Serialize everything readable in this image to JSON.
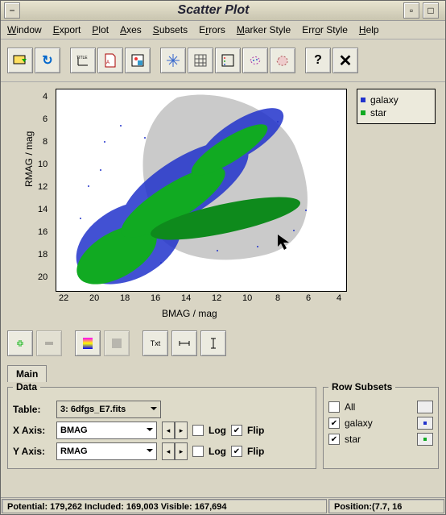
{
  "window": {
    "title": "Scatter Plot"
  },
  "menu": {
    "window": "Window",
    "export": "Export",
    "plot": "Plot",
    "axes": "Axes",
    "subsets": "Subsets",
    "errors": "Errors",
    "marker": "Marker Style",
    "errstyle": "Error Style",
    "help": "Help"
  },
  "chart_data": {
    "type": "scatter",
    "xlabel": "BMAG / mag",
    "ylabel": "RMAG / mag",
    "xlim": [
      23,
      3
    ],
    "ylim": [
      21,
      3
    ],
    "x_ticks": [
      22,
      20,
      18,
      16,
      14,
      12,
      10,
      8,
      6,
      4
    ],
    "y_ticks": [
      4,
      6,
      8,
      10,
      12,
      14,
      16,
      18,
      20
    ],
    "series": [
      {
        "name": "galaxy",
        "color": "#2233cc",
        "n_approx": 90000
      },
      {
        "name": "star",
        "color": "#11aa22",
        "n_approx": 79000
      }
    ],
    "annotations": [
      {
        "type": "freehand-selection",
        "description": "grey blob region roughly (BMAG 6–17, RMAG 3–18)"
      }
    ]
  },
  "legend": {
    "items": [
      {
        "label": "galaxy",
        "color": "#2233cc"
      },
      {
        "label": "star",
        "color": "#11aa22"
      }
    ]
  },
  "tabs": {
    "main": "Main"
  },
  "data_panel": {
    "legend": "Data",
    "table_label": "Table:",
    "table_value": "3: 6dfgs_E7.fits",
    "xaxis_label": "X Axis:",
    "xaxis_value": "BMAG",
    "yaxis_label": "Y Axis:",
    "yaxis_value": "RMAG",
    "log_label": "Log",
    "flip_label": "Flip",
    "x_log": false,
    "x_flip": true,
    "y_log": false,
    "y_flip": true
  },
  "subsets_panel": {
    "legend": "Row Subsets",
    "items": [
      {
        "label": "All",
        "checked": false,
        "color": ""
      },
      {
        "label": "galaxy",
        "checked": true,
        "color": "#2233cc"
      },
      {
        "label": "star",
        "checked": true,
        "color": "#11aa22"
      }
    ]
  },
  "status": {
    "left": "Potential: 179,262 Included: 169,003 Visible: 167,694",
    "right": "Position:(7.7, 16"
  }
}
